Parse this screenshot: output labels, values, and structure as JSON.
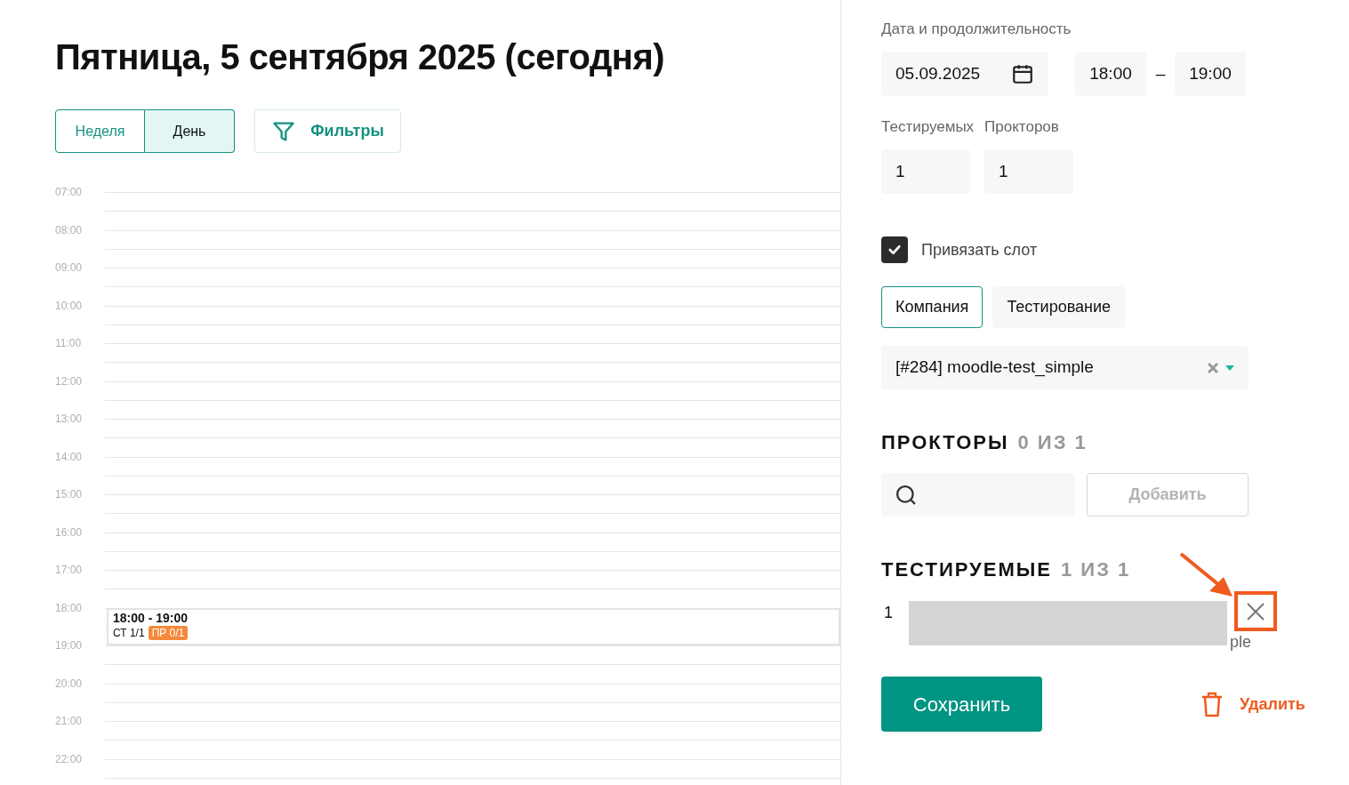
{
  "title": "Пятница, 5 сентября 2025 (сегодня)",
  "view_toggle": [
    {
      "label": "Неделя",
      "selected": false
    },
    {
      "label": "День",
      "selected": true
    }
  ],
  "filters_button": "Фильтры",
  "timeline": {
    "hours": [
      {
        "label": "07:00"
      },
      {
        "label": "08:00"
      },
      {
        "label": "09:00"
      },
      {
        "label": "10:00"
      },
      {
        "label": "11:00"
      },
      {
        "label": "12:00"
      },
      {
        "label": "13:00"
      },
      {
        "label": "14:00"
      },
      {
        "label": "15:00"
      },
      {
        "label": "16:00"
      },
      {
        "label": "17:00"
      },
      {
        "label": "18:00",
        "events": [
          {
            "time": "18:00 - 19:00",
            "testees": "СТ 1/1",
            "proctors_badge": "ПР 0/1"
          }
        ]
      },
      {
        "label": "19:00"
      },
      {
        "label": "20:00"
      },
      {
        "label": "21:00"
      },
      {
        "label": "22:00"
      }
    ]
  },
  "form": {
    "date_label": "Дата и продолжительность",
    "date": "05.09.2025",
    "start": "18:00",
    "dash": "–",
    "end": "19:00",
    "counts": [
      {
        "label": "Тестируемых",
        "value": "1"
      },
      {
        "label": "Прокторов",
        "value": "1"
      }
    ],
    "bind_slot": {
      "label": "Привязать слот",
      "checked": true
    },
    "source_tabs": [
      {
        "label": "Компания",
        "selected": true
      },
      {
        "label": "Тестирование",
        "selected": false
      }
    ],
    "test_select": {
      "value": "[#284] moodle-test_simple"
    },
    "proctors": {
      "title": "ПРОКТОРЫ",
      "count": "0 ИЗ 1",
      "add_button": {
        "label": "Добавить",
        "disabled": true
      }
    },
    "testees": {
      "title": "ТЕСТИРУЕМЫЕ",
      "count": "1 ИЗ 1",
      "rows": [
        {
          "number": "1",
          "name_tail": "ple",
          "redacted": true
        }
      ]
    },
    "save_button": "Сохранить",
    "delete_button": "Удалить"
  }
}
